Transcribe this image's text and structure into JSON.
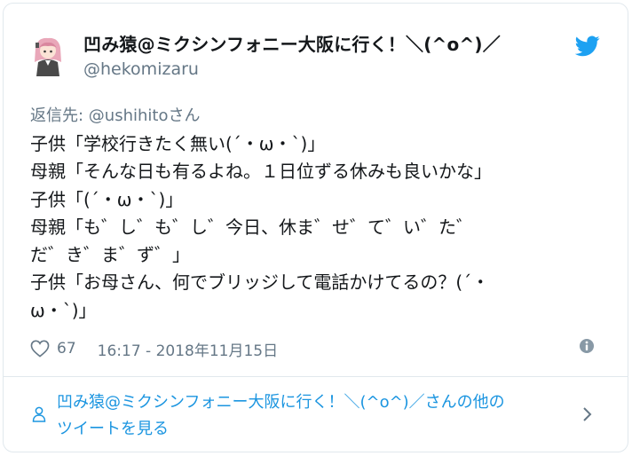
{
  "author": {
    "display_name": "凹み猿@ミクシンフォニー大阪に行く！＼(^o^)／",
    "handle": "@hekomizaru",
    "avatar_icon": "avatar-icon"
  },
  "brand": {
    "icon": "twitter-bird-icon",
    "color": "#1da1f2"
  },
  "reply": {
    "prefix": "返信先: ",
    "mention": "@ushihito",
    "suffix": "さん"
  },
  "tweet": {
    "lines": [
      "子供「学校行きたく無い(´・ω・`)」",
      "母親「そんな日も有るよね。１日位ずる休みも良いかな」",
      "子供「(´・ω・`)」",
      "母親「も゛し゛も゛し゛今日、休ま゛せ゛て゛い゛た゛",
      "だ゛き゛ま゛ず゛」",
      "子供「お母さん、何でブリッジして電話かけてるの？(´・",
      "ω・`)」"
    ]
  },
  "meta": {
    "heart_icon": "heart-icon",
    "likes": "67",
    "timestamp": "16:17 - 2018年11月15日",
    "info_icon": "info-icon"
  },
  "more_tweets": {
    "line1": "凹み猿@ミクシンフォニー大阪に行く！＼(^o^)／さんの他の",
    "line2": "ツイートを見る",
    "person_icon": "person-icon",
    "chevron_icon": "chevron-right-icon"
  },
  "colors": {
    "text": "#14171a",
    "secondary": "#657786",
    "link": "#1b95e0",
    "border": "#e1e8ed"
  }
}
